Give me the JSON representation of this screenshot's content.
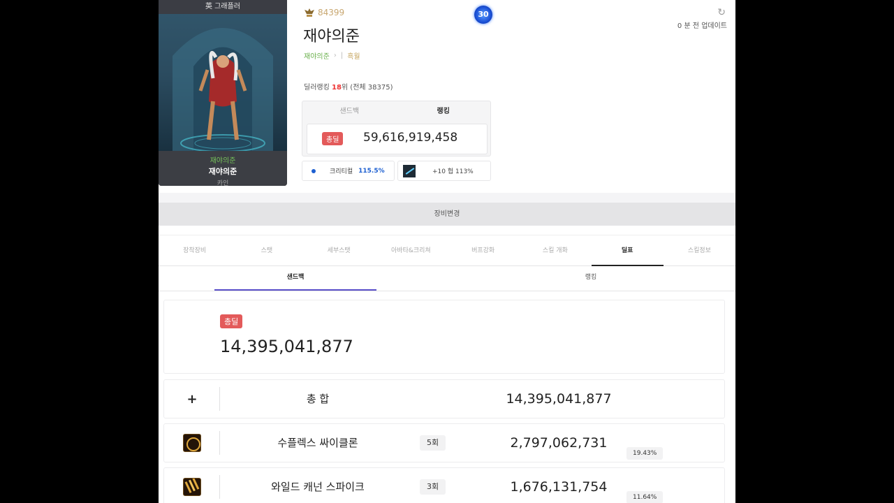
{
  "character_card": {
    "header": "英 그래플러",
    "adventure_name": "재야의준",
    "character_name": "재야의준",
    "class": "카인"
  },
  "header": {
    "fame": "84399",
    "character_name": "재야의준",
    "breadcrumb": [
      "재야의준",
      "흑월"
    ],
    "level": "30",
    "update_text": "0 분 전 업데이트",
    "rank_prefix": "딜러랭킹",
    "rank_number": "18",
    "rank_suffix": "위 (전체 38375)"
  },
  "mini_box": {
    "tabs": [
      "샌드백",
      "랭킹"
    ],
    "active_tab": 1,
    "badge": "총딜",
    "amount": "59,616,919,458"
  },
  "stat_chips": {
    "crit_label": "크리티컬",
    "crit_value": "115.5%",
    "weapon_text": "+10 헙 113%"
  },
  "equip_change_label": "장비변경",
  "main_tabs": [
    "장착장비",
    "스탯",
    "세부스탯",
    "아바타&크리쳐",
    "버프강화",
    "스킬 개화",
    "딜표",
    "스킬정보"
  ],
  "main_tabs_active": 6,
  "sub_tabs": [
    "샌드백",
    "랭킹"
  ],
  "sub_tabs_active": 0,
  "total": {
    "badge": "총딜",
    "amount": "14,395,041,877"
  },
  "rows": [
    {
      "icon": "plus-icon",
      "name": "총 합",
      "count": "",
      "amount": "14,395,041,877",
      "percent": ""
    },
    {
      "icon": "skill-supplex-cyclone-icon",
      "name": "수플렉스 싸이클론",
      "count": "5회",
      "amount": "2,797,062,731",
      "percent": "19.43%"
    },
    {
      "icon": "skill-wild-cannon-spike-icon",
      "name": "와일드 캐넌 스파이크",
      "count": "3회",
      "amount": "1,676,131,754",
      "percent": "11.64%"
    }
  ],
  "colors": {
    "accent_red": "#e35a5a",
    "crit_blue": "#1d5fd1",
    "subtab_underline": "#5a4fc9",
    "fame_gold": "#c8a770"
  }
}
